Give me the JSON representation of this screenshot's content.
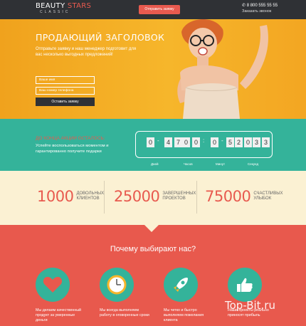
{
  "header": {
    "brand_part1": "BEAUTY",
    "brand_part2": "STARS",
    "brand_sub": "CLASSIC",
    "cta_label": "Отправить заявку",
    "phone": "8 800 555 55 55",
    "callback_label": "Заказать звонок"
  },
  "hero": {
    "title_part1": "ПРОДАЮЩИЙ",
    "title_part2": "ЗАГОЛОВОК",
    "subtitle": "Отправьте заявку и наш менеджер подготовит для вас несколько выгодных предложений!",
    "name_placeholder": "Ваше имя",
    "phone_placeholder": "Ваш номер телефона",
    "submit_label": "Оставить заявку"
  },
  "promo": {
    "title": "ДО КОНЦА АКЦИИ ОСТАЛОСЬ:",
    "text": "Успейте воспользоваться моментом и гарантированно получите подарки",
    "timer": {
      "days": [
        "0",
        "4",
        "7"
      ],
      "hours": [
        "0",
        "0"
      ],
      "minutes": [
        "0",
        "5",
        "2"
      ],
      "seconds": [
        "0",
        "3",
        "3"
      ],
      "labels": [
        "Дней",
        "Часов",
        "Минут",
        "Секунд"
      ]
    }
  },
  "stats": [
    {
      "number": "1000",
      "line1": "ДОВОЛЬНЫХ",
      "line2": "КЛИЕНТОВ"
    },
    {
      "number": "25000",
      "line1": "ЗАВЕРШЕННЫХ",
      "line2": "ПРОЕКТОВ"
    },
    {
      "number": "75000",
      "line1": "СЧАСТЛИВЫХ",
      "line2": "УЛЫБОК"
    }
  ],
  "features": {
    "title": "Почему выбирают нас?",
    "items": [
      {
        "icon": "heart-icon",
        "text": "Мы делаем качественный продукт за умеренные деньги"
      },
      {
        "icon": "clock-icon",
        "text": "Мы всегда выполняем работу в оговоренные сроки"
      },
      {
        "icon": "rocket-icon",
        "text": "Мы четко и быстро выполняем пожелания клиента"
      },
      {
        "icon": "thumbs-up-icon",
        "text": "Наши проекты реально приносят прибыль"
      }
    ]
  },
  "watermark": "Top-Bit.ru",
  "colors": {
    "accent": "#e85a4f",
    "teal": "#34b39a",
    "dark": "#2f3135",
    "yellow": "#f6b62b",
    "cream": "#fbf1d3"
  }
}
